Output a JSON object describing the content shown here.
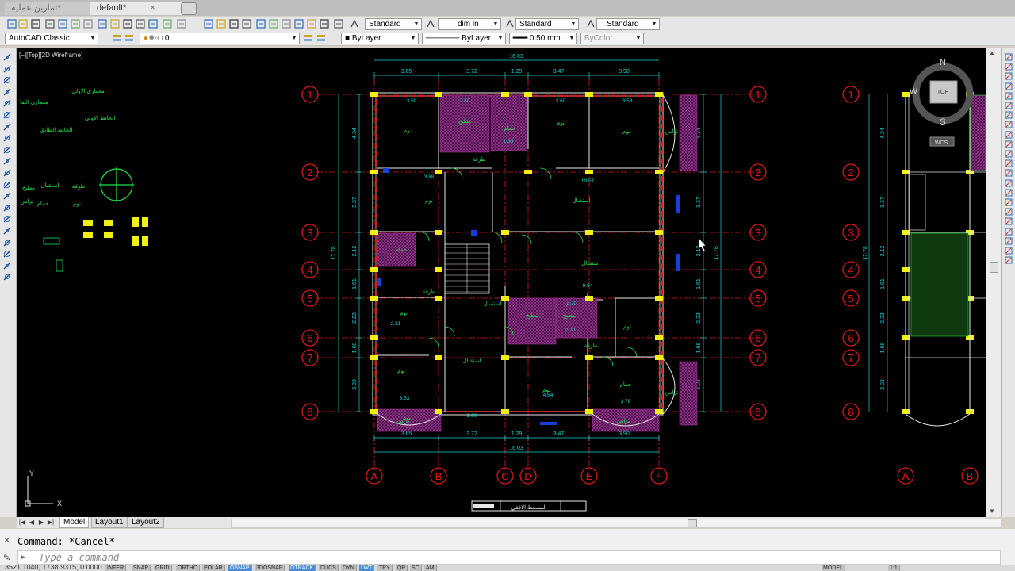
{
  "tabs": [
    {
      "label": "تمارین عملیة*",
      "active": false
    },
    {
      "label": "default*",
      "active": true
    }
  ],
  "toolbar": {
    "text_style": "Standard",
    "dim_style": "dim in",
    "table_style": "Standard",
    "multileader_style": "Standard",
    "workspace": "AutoCAD Classic",
    "layer_current": "0",
    "color": "ByLayer",
    "linetype": "ByLayer",
    "lineweight": "0.50 mm",
    "plotstyle": "ByColor"
  },
  "viewport_label": "[−][Top][2D Wireframe]",
  "viewcube": {
    "n": "N",
    "s": "S",
    "w": "W",
    "top": "TOP",
    "wcs": "WCS"
  },
  "grid_rows": [
    "1",
    "2",
    "3",
    "4",
    "5",
    "6",
    "7",
    "8"
  ],
  "grid_cols": [
    "A",
    "B",
    "C",
    "D",
    "E",
    "F"
  ],
  "grid_cols_right": [
    "A",
    "B"
  ],
  "dims_top": [
    "3.65",
    "3.72",
    "1.29",
    "3.47",
    "3.90"
  ],
  "dims_top_total": "16.03",
  "dims_bottom": [
    "3.65",
    "3.72",
    "1.29",
    "3.47",
    "3.90"
  ],
  "dims_bottom_total": "16.03",
  "dims_left": [
    "4.34",
    "3.37",
    "2.12",
    "1.61",
    "2.23",
    "1.68",
    "3.03"
  ],
  "dims_left_total": "17.78",
  "dims_right": [
    "4.34",
    "3.37",
    "2.12",
    "1.61",
    "2.23",
    "1.68",
    "3.03"
  ],
  "dims_right_total": "17.78",
  "dims_inner": [
    "3.50",
    "2.80",
    "3.60",
    "3.53",
    "3.88",
    "10.57",
    "9.54",
    "3.70",
    "2.70",
    "4.64",
    "3.78",
    "3.53",
    "3.60",
    "2.31",
    "1.35"
  ],
  "rooms": [
    "نوم",
    "مطبخ",
    "حمام",
    "نوم",
    "نوم",
    "تراس",
    "طرقة",
    "نوم",
    "استقبال",
    "حمام",
    "طرقة",
    "استقبال",
    "مطبخ",
    "مطبخ",
    "طرقة",
    "نوم",
    "استقبال",
    "نوم",
    "حمام",
    "نوم",
    "نوم",
    "استقبال",
    "نوم",
    "تراس",
    "تراس",
    "تراس"
  ],
  "legend_labels": [
    "معماري الاولي",
    "معماري التفا",
    "الحائط الاولي",
    "الحائط الطابق",
    "مطبخ",
    "استقبال",
    "طرقة",
    "نوم",
    "حمام",
    "تراس"
  ],
  "title_block": "المسقط الافقي",
  "ucs": {
    "x": "X",
    "y": "Y"
  },
  "layout_tabs": [
    "Model",
    "Layout1",
    "Layout2"
  ],
  "command_history": "Command: *Cancel*",
  "command_placeholder": "Type a command",
  "status": {
    "coords": "3521.1040, 1738.9315, 0.0000",
    "buttons": [
      "INFER",
      "SNAP",
      "GRID",
      "ORTHO",
      "POLAR",
      "OSNAP",
      "3DOSNAP",
      "OTRACK",
      "DUCS",
      "DYN",
      "LWT",
      "TPY",
      "QP",
      "SC",
      "AM"
    ],
    "active": [
      "OSNAP",
      "OTRACK",
      "LWT"
    ],
    "model": "MODEL",
    "scale": "1:1"
  }
}
